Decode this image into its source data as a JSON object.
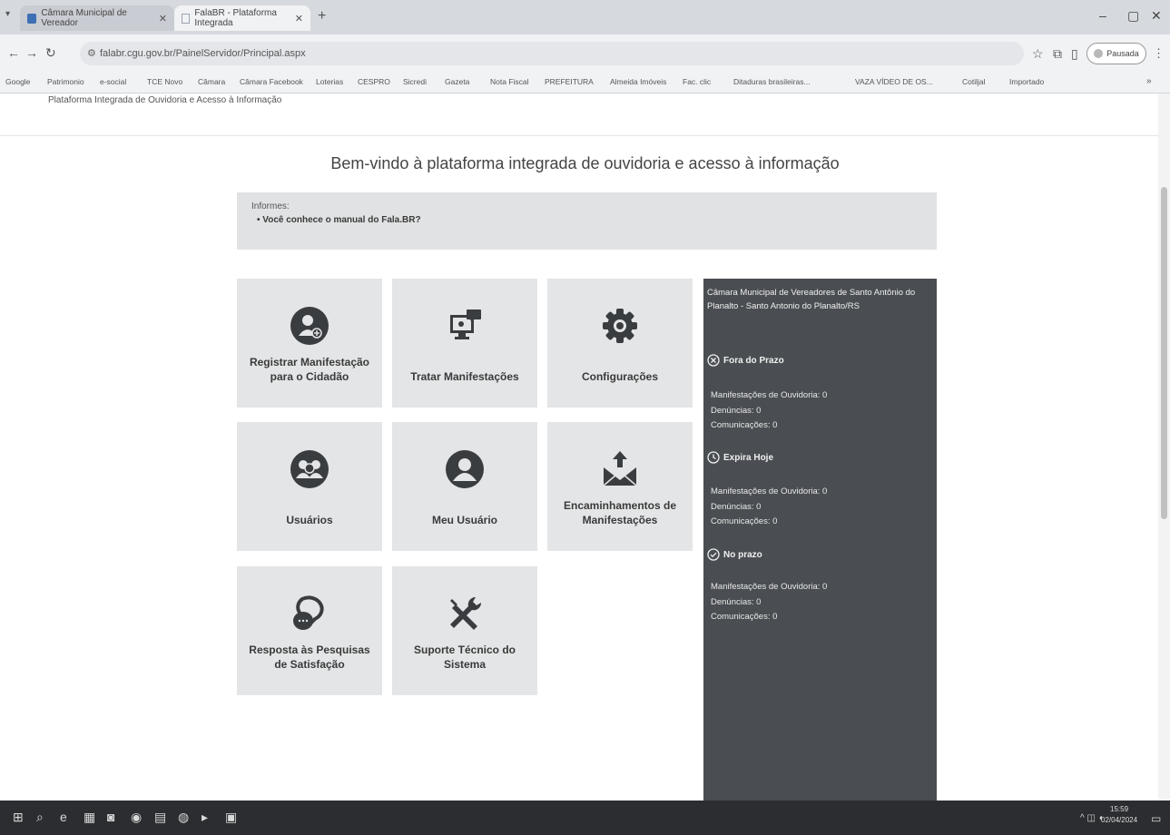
{
  "browser": {
    "tabs": [
      {
        "title": "Câmara Municipal de Vereador",
        "fav_color": "#3c6fb4"
      },
      {
        "title": "FalaBR - Plataforma Integrada",
        "fav_color": "#9aa4b0"
      }
    ],
    "url": "falabr.cgu.gov.br/PainelServidor/Principal.aspx",
    "profile_label": "Pausada",
    "bookmarks": [
      "Google",
      "Patrimonio",
      "e-social",
      "TCE Novo",
      "Câmara",
      "Câmara Facebook",
      "Loterias",
      "CESPRO",
      "Sicredi",
      "Gazeta",
      "Nota Fiscal",
      "PREFEITURA",
      "Almeida Imóveis",
      "Fac. clic",
      "Ditaduras brasileiras...",
      "VAZA VÍDEO DE OS...",
      "Cotiljal",
      "Importado"
    ]
  },
  "page": {
    "subtitle": "Plataforma Integrada de Ouvidoria e Acesso à Informação",
    "welcome": "Bem-vindo à plataforma integrada de ouvidoria e acesso à informação",
    "info_header": "Informes:",
    "info_link": "Você conhece o manual do Fala.BR?",
    "tiles": [
      {
        "label": "Registrar Manifestação para o Cidadão",
        "icon": "add-user-icon"
      },
      {
        "label": "Tratar Manifestações",
        "icon": "monitor-chat-icon"
      },
      {
        "label": "Configurações",
        "icon": "gear-icon"
      },
      {
        "label": "Usuários",
        "icon": "users-icon"
      },
      {
        "label": "Meu Usuário",
        "icon": "user-icon"
      },
      {
        "label": "Encaminhamentos de Manifestações",
        "icon": "mail-forward-icon"
      },
      {
        "label": "Resposta às Pesquisas de Satisfação",
        "icon": "chat-bubbles-icon"
      },
      {
        "label": "Suporte Técnico do Sistema",
        "icon": "tools-icon"
      }
    ]
  },
  "panel": {
    "org": "Câmara Municipal de Vereadores de Santo Antônio do Planalto - Santo Antonio do Planalto/RS",
    "sections": [
      {
        "title": "Fora do Prazo",
        "rows": [
          "Manifestações de Ouvidoria: 0",
          "Denúncias: 0",
          "Comunicações: 0"
        ]
      },
      {
        "title": "Expira Hoje",
        "rows": [
          "Manifestações de Ouvidoria: 0",
          "Denúncias: 0",
          "Comunicações: 0"
        ]
      },
      {
        "title": "No prazo",
        "rows": [
          "Manifestações de Ouvidoria: 0",
          "Denúncias: 0",
          "Comunicações: 0"
        ]
      }
    ]
  },
  "taskbar": {
    "time": "15:59",
    "date": "02/04/2024"
  },
  "colors": {
    "tile_bg": "#e4e5e6",
    "icon_dark": "#3a3d40",
    "panel_bg": "#4a4e52"
  }
}
